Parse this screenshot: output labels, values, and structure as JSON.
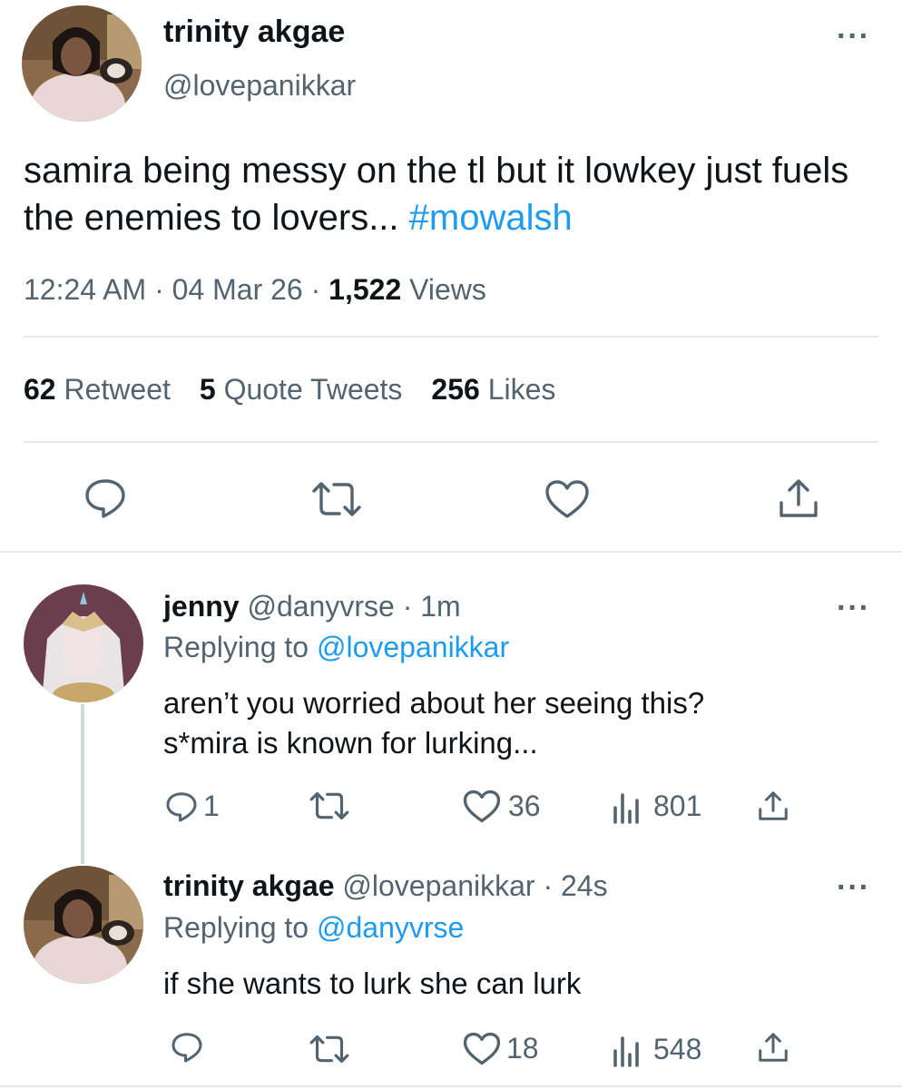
{
  "main_tweet": {
    "author_name": "trinity akgae",
    "author_handle": "@lovepanikkar",
    "text": "samira being messy on the tl but it lowkey just fuels the enemies to lovers...",
    "hashtag": "#mowalsh",
    "time": "12:24 AM",
    "date": "04 Mar 26",
    "views_count": "1,522",
    "views_label": "Views",
    "retweets_count": "62",
    "retweets_label": "Retweet",
    "quotes_count": "5",
    "quotes_label": "Quote Tweets",
    "likes_count": "256",
    "likes_label": "Likes"
  },
  "replies": [
    {
      "author_name": "jenny",
      "author_handle": "@danyvrse",
      "time": "1m",
      "replying_to_label": "Replying to",
      "replying_to_handle": "@lovepanikkar",
      "text_line1": "aren’t you worried about her seeing this?",
      "text_line2": "s*mira is known for lurking...",
      "reply_count": "1",
      "like_count": "36",
      "view_count": "801"
    },
    {
      "author_name": "trinity akgae",
      "author_handle": "@lovepanikkar",
      "time": "24s",
      "replying_to_label": "Replying to",
      "replying_to_handle": "@danyvrse",
      "text": "if she wants to lurk she can lurk",
      "like_count": "18",
      "view_count": "548"
    }
  ],
  "icons": {
    "more": "more-icon",
    "reply": "reply-icon",
    "retweet": "retweet-icon",
    "like": "heart-icon",
    "share": "share-icon",
    "views": "views-icon"
  },
  "colors": {
    "accent": "#1d9bf0",
    "muted": "#536471",
    "text": "#0f1419",
    "divider": "#e6e9ec"
  }
}
